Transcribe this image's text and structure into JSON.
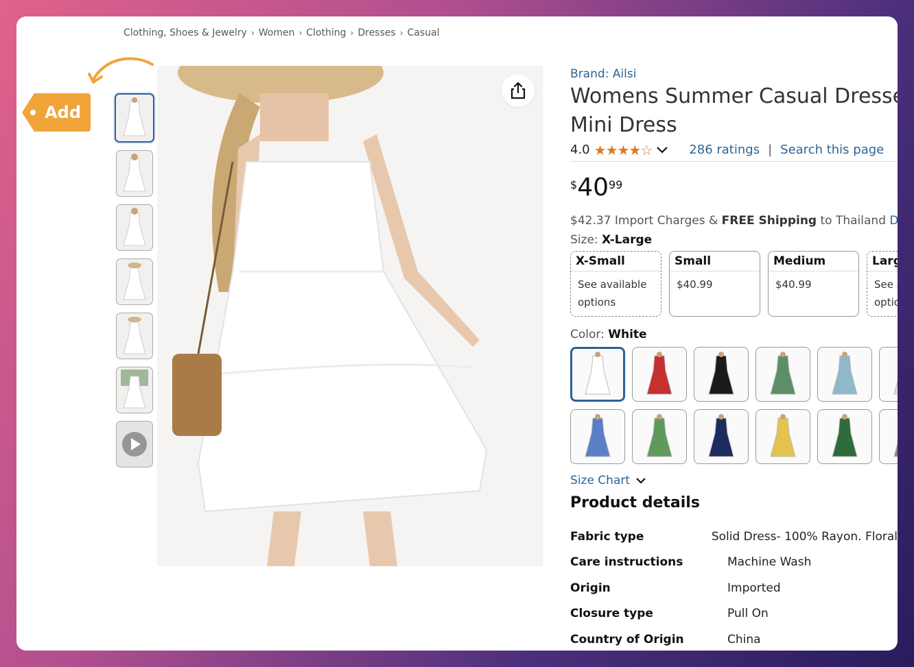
{
  "breadcrumb": [
    "Clothing, Shoes & Jewelry",
    "Women",
    "Clothing",
    "Dresses",
    "Casual"
  ],
  "breadcrumb_separator": "›",
  "add_tag": {
    "label": "Add",
    "color": "#f0a43a"
  },
  "thumbnails": [
    "dress-front",
    "dress-front-2",
    "dress-side",
    "dress-hat",
    "dress-hat-2",
    "dress-outdoor",
    "video-thumbnail"
  ],
  "product": {
    "brand": "Brand: Ailsi",
    "title_line1": "Womens Summer Casual Dresses",
    "title_line2": "Mini Dress",
    "rating": "4.0",
    "stars": "★★★★☆",
    "ratings_count": "286 ratings",
    "search_page": "Search this page",
    "price_currency": "$",
    "price_whole": "40",
    "price_fraction": "99",
    "import_charges": "$42.37 Import Charges &",
    "free_shipping": "FREE Shipping",
    "ship_to": "to Thailand",
    "details_link": "Details",
    "size_label": "Size:",
    "size_selected": "X-Large",
    "sizes": [
      {
        "name": "X-Small",
        "line1": "See available",
        "line2": "options"
      },
      {
        "name": "Small",
        "line1": "$40.99",
        "line2": ""
      },
      {
        "name": "Medium",
        "line1": "$40.99",
        "line2": ""
      },
      {
        "name": "Large",
        "line1": "See available",
        "line2": "options"
      }
    ],
    "color_label": "Color:",
    "color_selected": "White",
    "colors": [
      "#ffffff",
      "#c53030",
      "#1a1a1a",
      "#5c8f65",
      "#8fb8c9",
      "#dddddd",
      "#5b7fc7",
      "#5f9a5c",
      "#1d2b5e",
      "#e2c44e",
      "#2e6b3c",
      "#888888"
    ],
    "size_chart": "Size Chart"
  },
  "details_title": "Product details",
  "details": [
    {
      "key": "Fabric type",
      "value": "Solid Dress- 100% Rayon. Floral"
    },
    {
      "key": "Care instructions",
      "value": "Machine Wash"
    },
    {
      "key": "Origin",
      "value": "Imported"
    },
    {
      "key": "Closure type",
      "value": "Pull On"
    },
    {
      "key": "Country of Origin",
      "value": "China"
    }
  ]
}
